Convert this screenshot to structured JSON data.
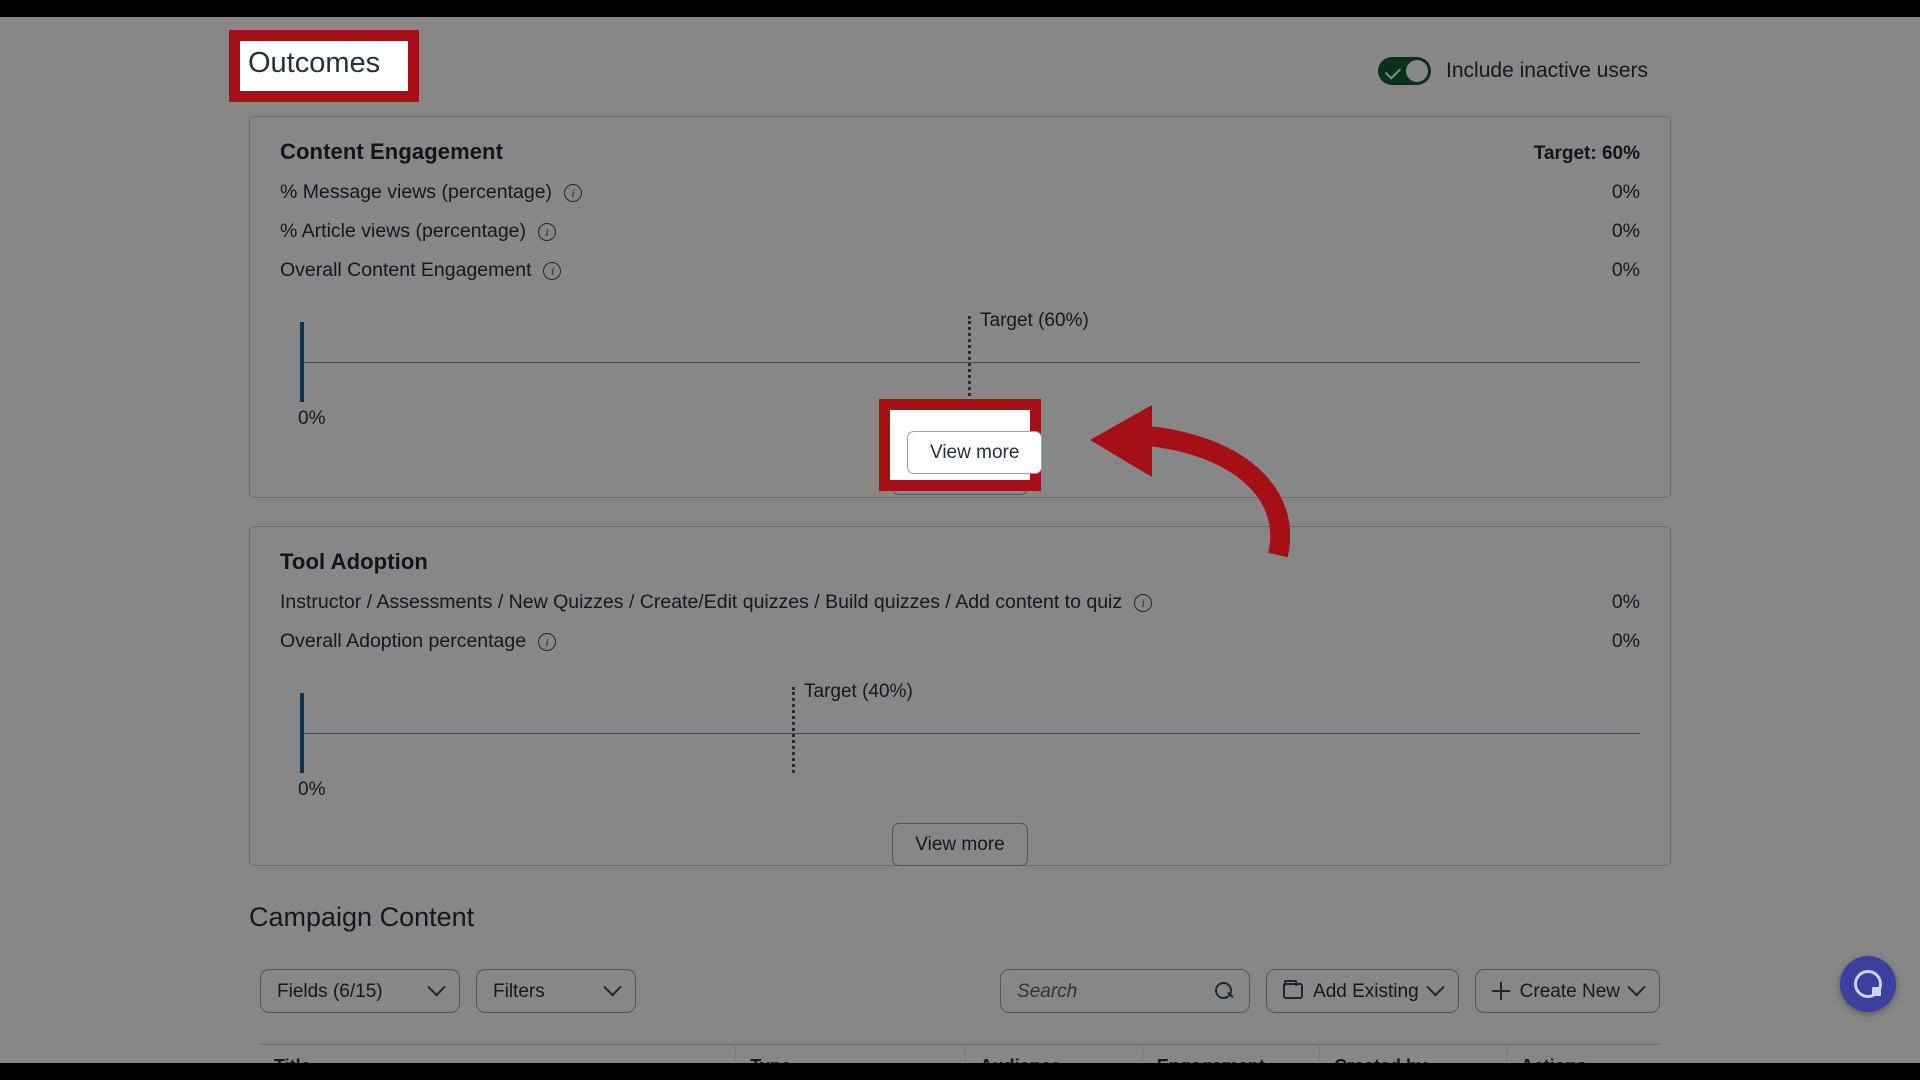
{
  "header": {
    "page_title": "Outcomes",
    "include_inactive_label": "Include inactive users",
    "include_inactive_on": true,
    "toggle_color": "#115c2e"
  },
  "cards": [
    {
      "id": "content-engagement",
      "title": "Content Engagement",
      "target_label": "Target: 60%",
      "metrics": [
        {
          "label": "% Message views (percentage)",
          "value": "0%"
        },
        {
          "label": "% Article views (percentage)",
          "value": "0%"
        },
        {
          "label": "Overall Content Engagement",
          "value": "0%"
        }
      ],
      "chart": {
        "target_line_label": "Target (60%)",
        "zero_label": "0%"
      },
      "view_more_label": "View more"
    },
    {
      "id": "tool-adoption",
      "title": "Tool Adoption",
      "target_label": "",
      "metrics": [
        {
          "label": "Instructor / Assessments / New Quizzes / Create/Edit quizzes / Build quizzes / Add content to quiz",
          "value": "0%"
        },
        {
          "label": "Overall Adoption percentage",
          "value": "0%"
        }
      ],
      "chart": {
        "target_line_label": "Target (40%)",
        "zero_label": "0%"
      },
      "view_more_label": "View more"
    }
  ],
  "chart_data": [
    {
      "type": "bar",
      "title": "Content Engagement",
      "categories": [
        "Overall Content Engagement"
      ],
      "values": [
        0
      ],
      "xlabel": "",
      "ylabel": "",
      "xlim": [
        0,
        100
      ],
      "target": 60,
      "target_label": "Target (60%)",
      "tick_labels": [
        "0%"
      ],
      "grid": false,
      "legend": "none",
      "orientation": "horizontal"
    },
    {
      "type": "bar",
      "title": "Tool Adoption",
      "categories": [
        "Overall Adoption percentage"
      ],
      "values": [
        0
      ],
      "xlabel": "",
      "ylabel": "",
      "xlim": [
        0,
        100
      ],
      "target": 40,
      "target_label": "Target (40%)",
      "tick_labels": [
        "0%"
      ],
      "grid": false,
      "legend": "none",
      "orientation": "horizontal"
    }
  ],
  "campaign": {
    "section_title": "Campaign Content",
    "fields_label": "Fields (6/15)",
    "filters_label": "Filters",
    "search_placeholder": "Search",
    "search_value": "",
    "add_existing_label": "Add Existing",
    "create_new_label": "Create New",
    "columns": [
      "Title",
      "Type",
      "Audience",
      "Engagement",
      "Created by",
      "Actions"
    ]
  },
  "annotations": {
    "highlight_color": "#a50f16",
    "title_highlight": "Outcomes",
    "button_highlight": "View more",
    "arrow": "curved-arrow-pointing-left"
  },
  "fab": {
    "name": "help-chat-button",
    "color": "#3b3f9e"
  }
}
